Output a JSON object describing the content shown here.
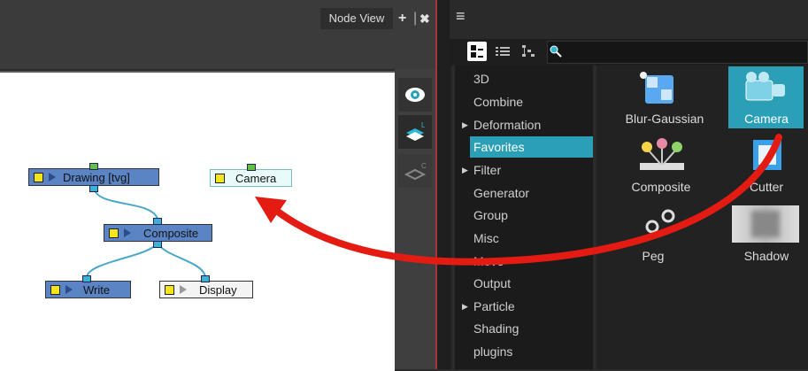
{
  "node_view": {
    "title": "Node View",
    "add_label": "+",
    "close_label": "✖",
    "nodes": {
      "drawing": "Drawing  [tvg]",
      "camera": "Camera",
      "composite": "Composite",
      "write": "Write",
      "display": "Display"
    }
  },
  "library": {
    "menu_label": "≡",
    "categories": [
      "3D",
      "Combine",
      "Deformation",
      "Favorites",
      "Filter",
      "Generator",
      "Group",
      "Misc",
      "Move",
      "Output",
      "Particle",
      "Shading",
      "plugins"
    ],
    "selected_category": "Favorites",
    "items": {
      "blur": "Blur-Gaussian",
      "camera": "Camera",
      "composite": "Composite",
      "cutter": "Cutter",
      "peg": "Peg",
      "shadow": "Shadow"
    }
  },
  "colors": {
    "selection": "#2a9fb6",
    "annotation_arrow": "#e31b12",
    "node_blue": "#5b84c4"
  }
}
